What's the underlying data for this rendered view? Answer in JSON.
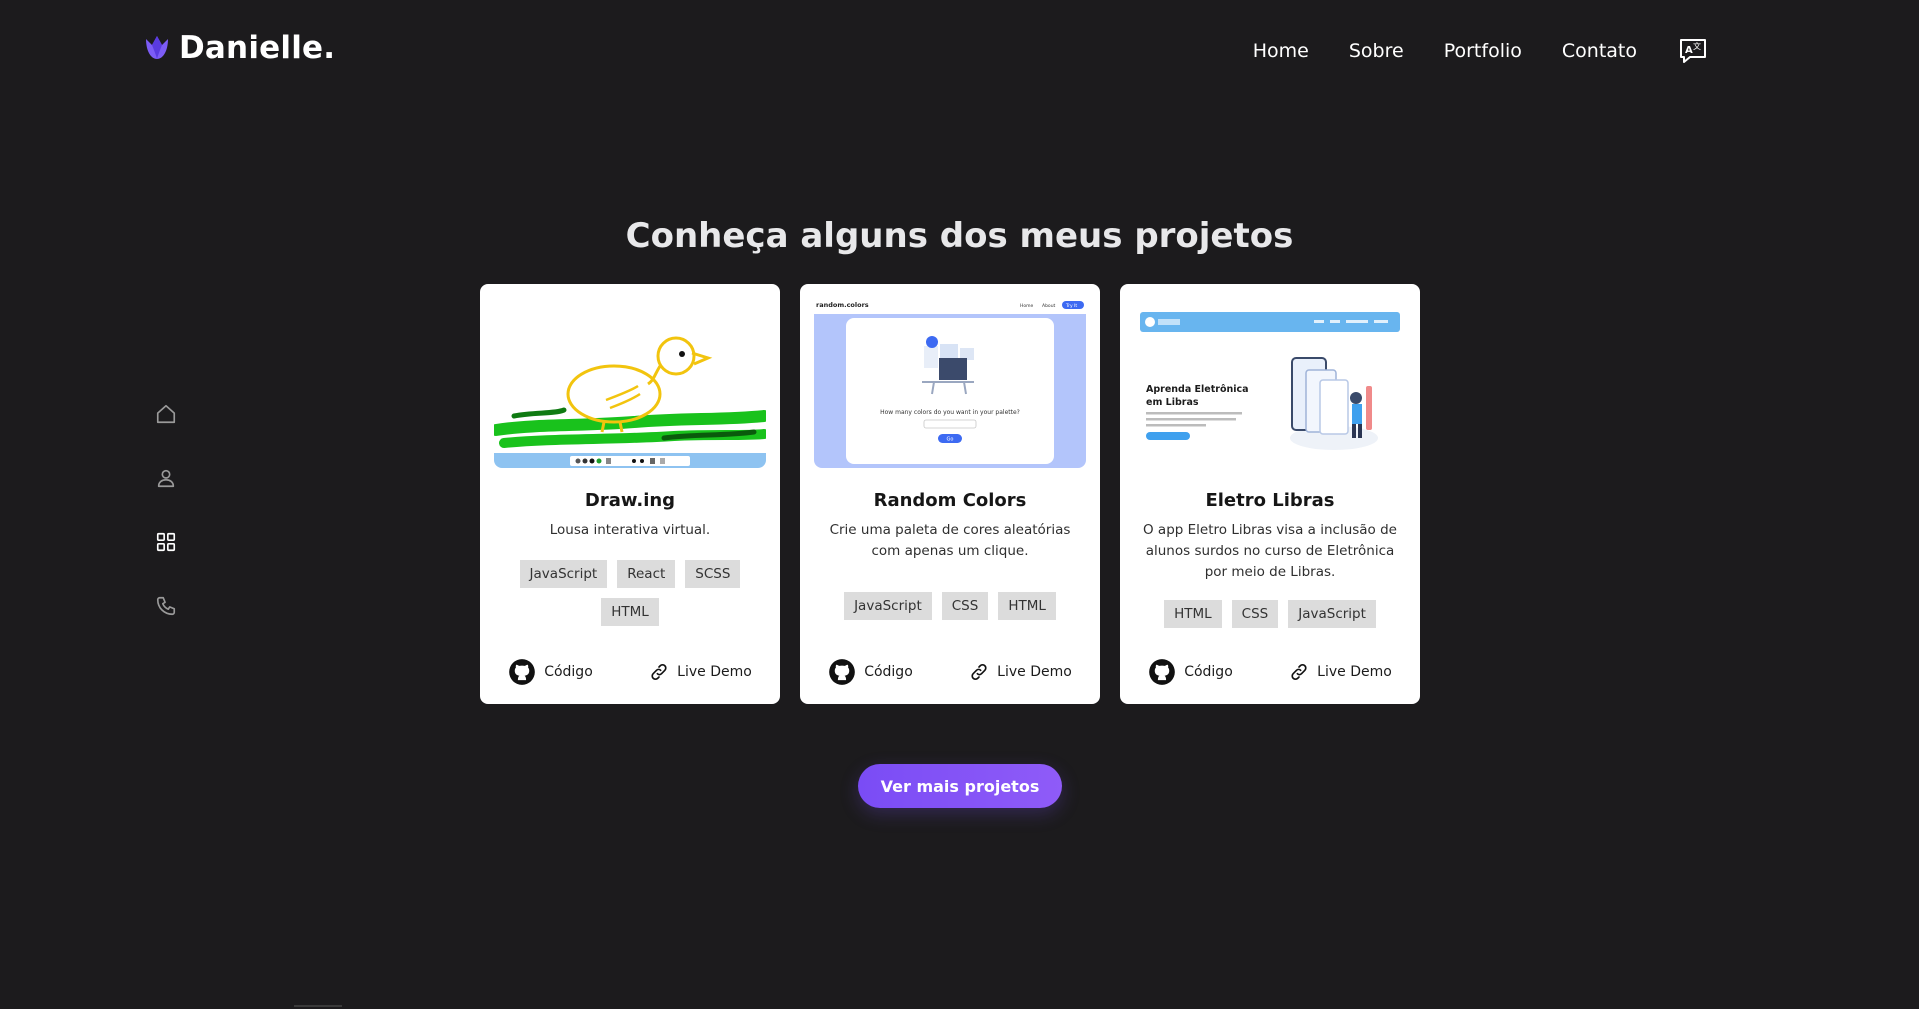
{
  "brand": {
    "name": "Danielle.",
    "logo_icon": "tulip-icon",
    "accent": "#7c5cf6"
  },
  "nav": {
    "items": [
      "Home",
      "Sobre",
      "Portfolio",
      "Contato"
    ],
    "language_icon": "translate-icon"
  },
  "sidenav": {
    "items": [
      {
        "icon": "home-icon",
        "active": false
      },
      {
        "icon": "user-icon",
        "active": false
      },
      {
        "icon": "grid-icon",
        "active": true
      },
      {
        "icon": "phone-icon",
        "active": false
      }
    ]
  },
  "section": {
    "title": "Conheça alguns dos meus projetos"
  },
  "projects": [
    {
      "title": "Draw.ing",
      "description": "Lousa interativa virtual.",
      "tags": [
        "JavaScript",
        "React",
        "SCSS",
        "HTML"
      ],
      "code_label": "Código",
      "demo_label": "Live Demo"
    },
    {
      "title": "Random Colors",
      "description": "Crie uma paleta de cores aleatórias com apenas um clique.",
      "tags": [
        "JavaScript",
        "CSS",
        "HTML"
      ],
      "code_label": "Código",
      "demo_label": "Live Demo",
      "thumb": {
        "brand": "random.colors",
        "nav": [
          "Home",
          "About",
          "Try It"
        ],
        "question": "How many colors do you want in your palette?",
        "button": "Go"
      }
    },
    {
      "title": "Eletro Libras",
      "description": "O app Eletro Libras visa a inclusão de alunos surdos no curso de Eletrônica por meio de Libras.",
      "tags": [
        "HTML",
        "CSS",
        "JavaScript"
      ],
      "code_label": "Código",
      "demo_label": "Live Demo",
      "thumb": {
        "heading": "Aprenda Eletrônica em Libras"
      }
    }
  ],
  "more_button": "Ver mais projetos"
}
